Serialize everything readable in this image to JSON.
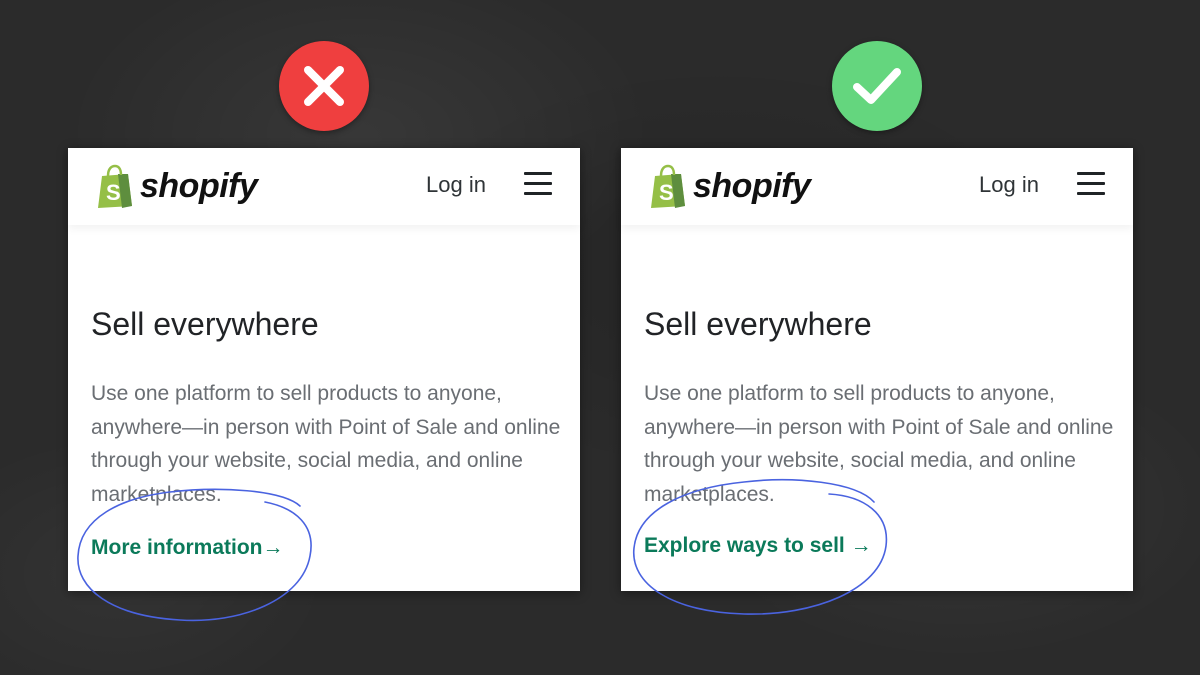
{
  "colors": {
    "bad_badge": "#ef3f3f",
    "good_badge": "#64d67e",
    "shopify_green": "#95bf47",
    "link_green": "#0b7a5a",
    "annotation_blue": "#4a63e0"
  },
  "badges": {
    "bad": {
      "icon": "x-icon"
    },
    "good": {
      "icon": "checkmark-icon"
    }
  },
  "cards": [
    {
      "logo_text": "shopify",
      "login_label": "Log in",
      "menu_icon": "hamburger-menu-icon",
      "heading": "Sell everywhere",
      "body": "Use one platform to sell products to anyone, anywhere—in person with Point of Sale and online through your website, social media, and online marketplaces.",
      "cta_label": "More information",
      "cta_arrow": "→"
    },
    {
      "logo_text": "shopify",
      "login_label": "Log in",
      "menu_icon": "hamburger-menu-icon",
      "heading": "Sell everywhere",
      "body": "Use one platform to sell products to anyone, anywhere—in person with Point of Sale and online through your website, social media, and online marketplaces.",
      "cta_label": "Explore ways to sell",
      "cta_arrow": "→"
    }
  ]
}
